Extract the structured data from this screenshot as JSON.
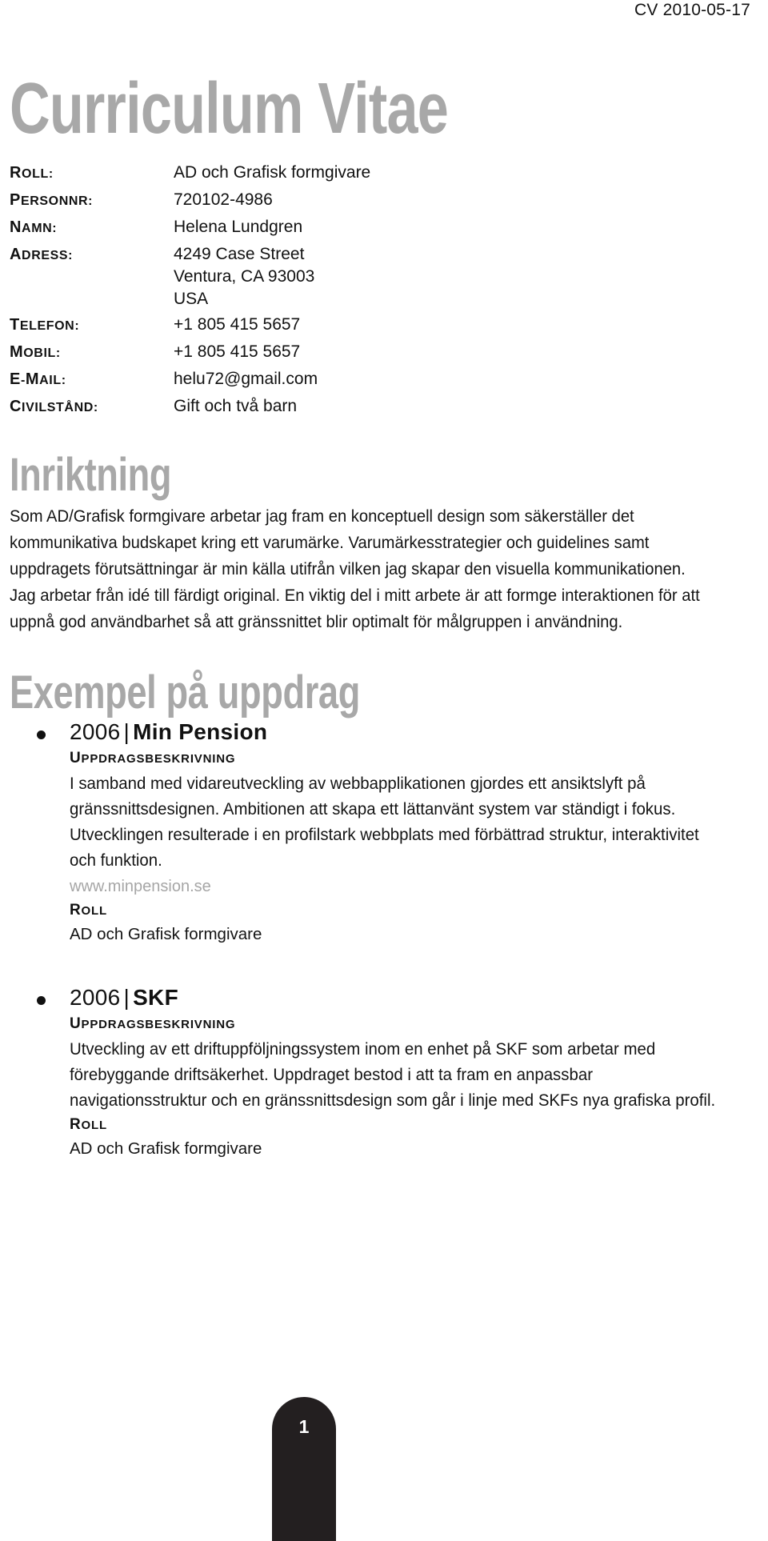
{
  "header": {
    "date_label": "CV 2010-05-17"
  },
  "title": {
    "main": "Curriculum Vitae"
  },
  "details": {
    "rows": [
      {
        "label": "Roll:",
        "value": "AD och Grafisk formgivare"
      },
      {
        "label": "Personnr:",
        "value": "720102-4986"
      },
      {
        "label": "Namn:",
        "value": "Helena Lundgren"
      },
      {
        "label": "Adress:",
        "value": "4249 Case Street\nVentura, CA 93003\nUSA"
      },
      {
        "label": "Telefon:",
        "value": "+1 805 415 5657"
      },
      {
        "label": "Mobil:",
        "value": "+1 805 415 5657"
      },
      {
        "label": "E-mail:",
        "value": "helu72@gmail.com"
      },
      {
        "label": "Civilstånd:",
        "value": "Gift och två barn"
      }
    ]
  },
  "inriktning": {
    "heading": "Inriktning",
    "paragraph": "Som AD/Grafisk formgivare arbetar jag fram en konceptuell design som säkerställer det kommunikativa budskapet kring ett varumärke. Varumärkesstrategier och guidelines samt uppdragets förutsättningar är min källa utifrån vilken jag skapar den visuella kommunikationen. Jag arbetar från idé till färdigt original. En viktig del i mitt arbete är att formge interaktionen för att uppnå god användbarhet så att gränssnittet blir optimalt för målgruppen i användning."
  },
  "exempel": {
    "heading": "Exempel på uppdrag",
    "assignments": [
      {
        "year": "2006",
        "separator": "|",
        "name": "Min Pension",
        "description_label": "Uppdragsbeskrivning",
        "description": "I samband med vidareutveckling av webbapplikationen gjordes ett ansiktslyft på gränssnittsdesignen. Ambitionen att skapa ett lättanvänt system var ständigt i fokus. Utvecklingen resulterade i en profilstark webbplats med förbättrad struktur, interaktivitet och funktion.",
        "url": "www.minpension.se",
        "role_label": "Roll",
        "role": "AD och Grafisk formgivare"
      },
      {
        "year": "2006",
        "separator": "|",
        "name": "SKF",
        "description_label": "Uppdragsbeskrivning",
        "description": "Utveckling av ett driftuppföljningssystem inom en enhet på SKF som arbetar med förebyggande driftsäkerhet. Uppdraget bestod i att ta fram en anpassbar navigationsstruktur och en gränssnittsdesign som går i linje med SKFs nya grafiska profil.",
        "url": "",
        "role_label": "Roll",
        "role": "AD och Grafisk formgivare"
      }
    ]
  },
  "footer": {
    "page_number": "1"
  },
  "colors": {
    "display_gray": "#a8a8a8",
    "body_black": "#141414",
    "url_gray": "#a6a6a6",
    "badge_dark": "#231f20"
  }
}
